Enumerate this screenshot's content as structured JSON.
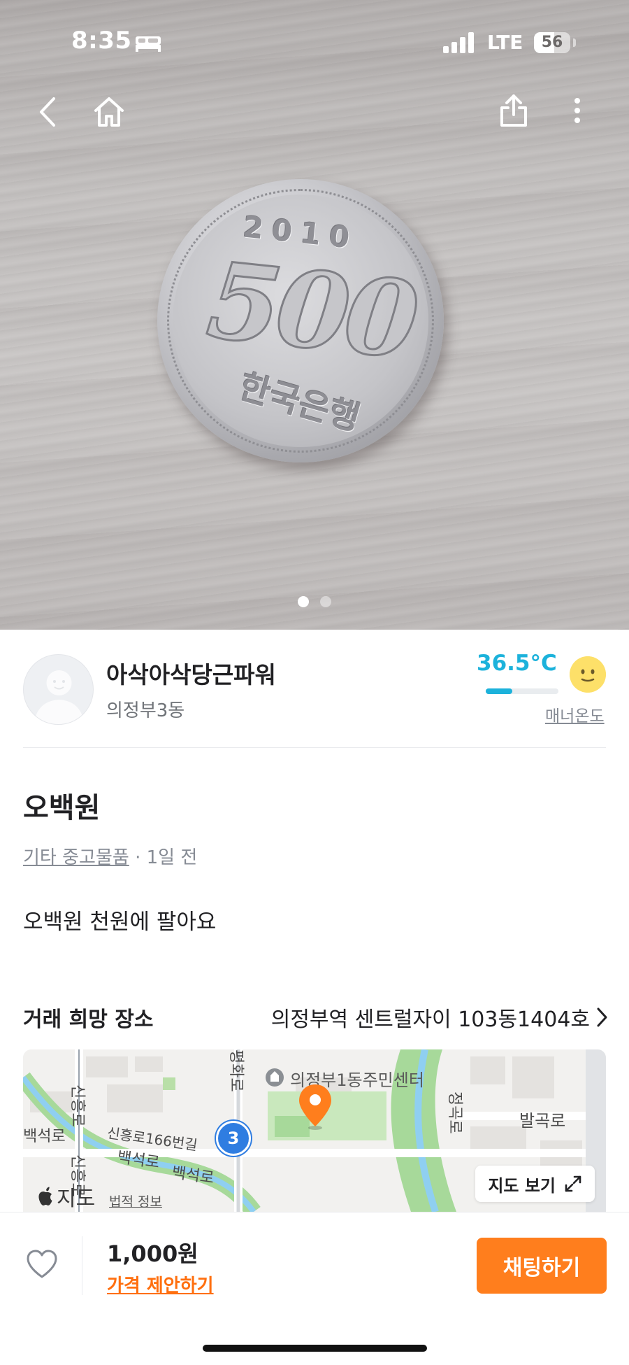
{
  "status_bar": {
    "time": "8:35",
    "network": "LTE",
    "battery": "56"
  },
  "carousel": {
    "total_images": 2,
    "active_index": 0
  },
  "coin": {
    "year": "2010",
    "value": "500",
    "text": "한국은행"
  },
  "seller": {
    "name": "아삭아삭당근파워",
    "location": "의정부3동",
    "manner_temp": "36.5°C",
    "manner_temp_level": 36.5,
    "manner_label": "매너온도"
  },
  "article": {
    "title": "오백원",
    "category": "기타 중고물품",
    "time_ago": "· 1일 전",
    "description": "오백원 천원에 팔아요"
  },
  "trade_place": {
    "label": "거래 희망 장소",
    "value": "의정부역 센트럴자이 103동1404호"
  },
  "map": {
    "labels": {
      "community_center": "의정부1동주민센터",
      "balgok": "발곡로",
      "jeonggok": "정곡로",
      "pyeonghwa": "평화로",
      "shinheung1": "신흥로",
      "shinheung2": "신흥로",
      "shinheung166": "신흥로166번길",
      "baekseok1": "백석로",
      "baekseok2": "백석로",
      "baekseok3": "백석로"
    },
    "route_number": "3",
    "view_button": "지도 보기",
    "logo": "지도",
    "legal": "법적 정보"
  },
  "bottom": {
    "price": "1,000원",
    "offer": "가격 제안하기",
    "chat": "채팅하기"
  },
  "colors": {
    "accent": "#ff7e1d",
    "offer": "#ff6f0f",
    "temp": "#1cb2db"
  }
}
